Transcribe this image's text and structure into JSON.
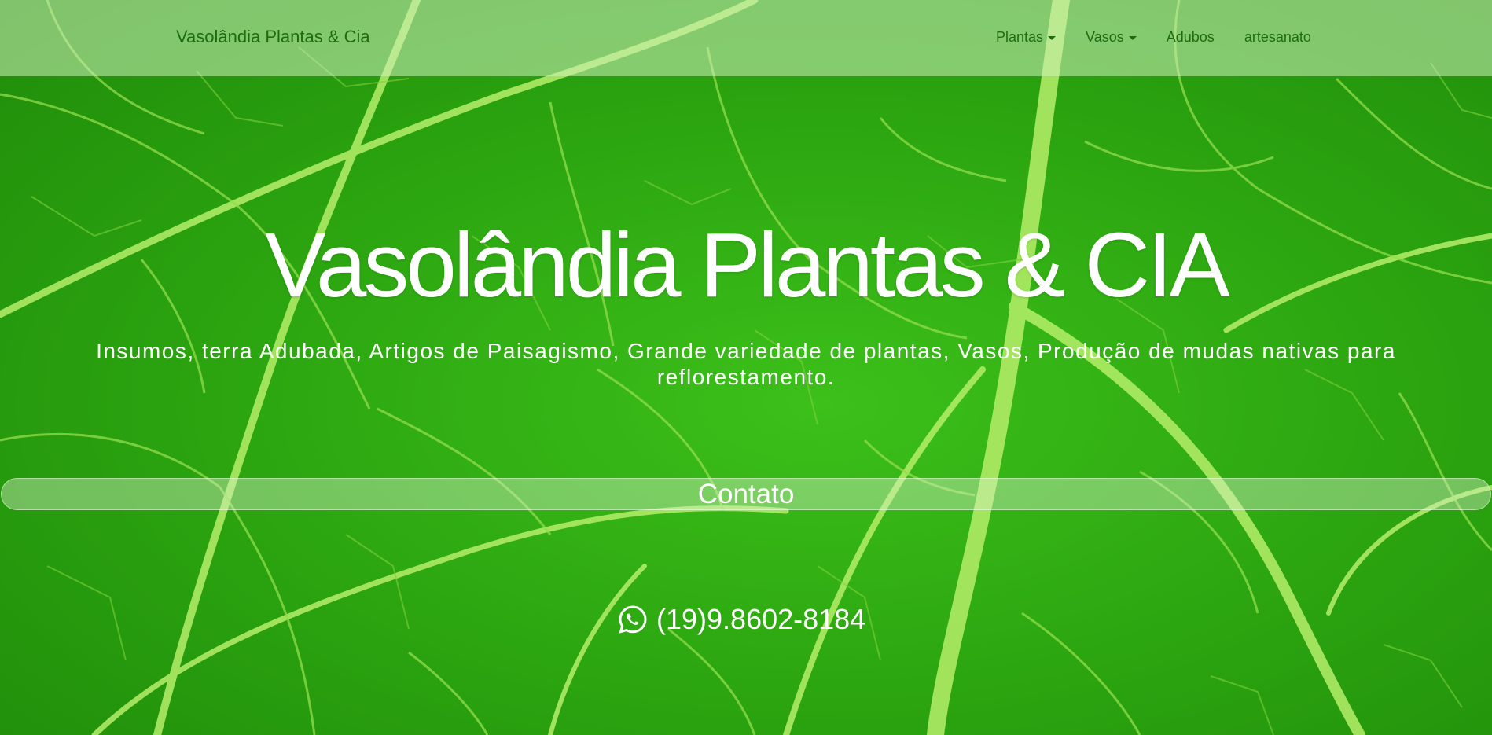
{
  "navbar": {
    "brand": "Vasolândia Plantas & Cia",
    "items": [
      {
        "label": "Plantas",
        "dropdown": true
      },
      {
        "label": "Vasos",
        "dropdown": true
      },
      {
        "label": "Adubos",
        "dropdown": false
      },
      {
        "label": "artesanato",
        "dropdown": false
      }
    ]
  },
  "hero": {
    "title": "Vasolândia Plantas & CIA",
    "subtitle": "Insumos, terra Adubada, Artigos de Paisagismo, Grande variedade de plantas, Vasos, Produção de mudas nativas para reflorestamento.",
    "contact_label": "Contato",
    "phone": "(19)9.8602-8184",
    "phone_icon": "whatsapp-icon"
  },
  "colors": {
    "nav_text": "#1f6b12",
    "leaf_green": "#2fa212",
    "vein": "#a8e86a",
    "text": "#ffffff"
  }
}
